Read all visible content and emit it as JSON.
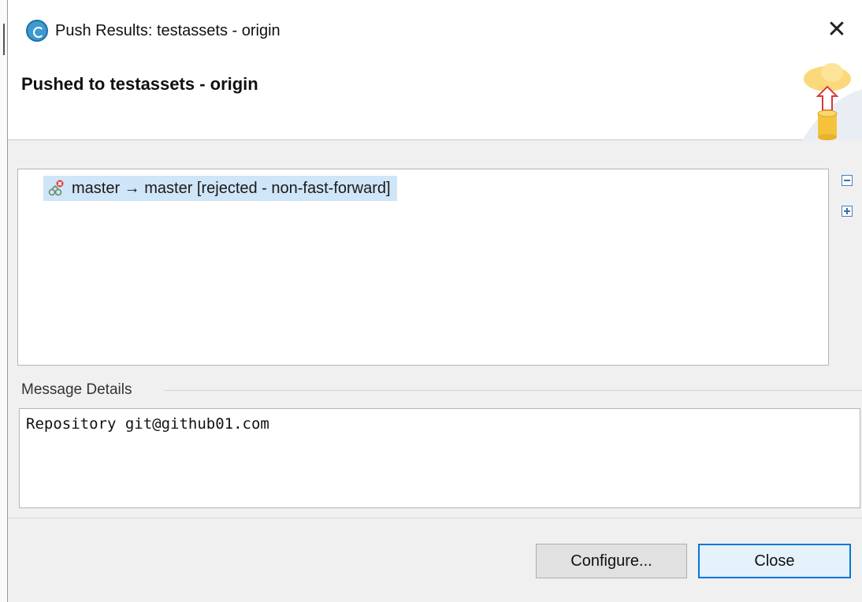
{
  "window": {
    "title": "Push Results: testassets - origin",
    "close_glyph": "✕"
  },
  "header": {
    "title": "Pushed to testassets - origin",
    "graphic_icon": "cloud-push-database-icon"
  },
  "results": {
    "items": [
      {
        "icon": "branch-rejected-icon",
        "label": "master → master [rejected - non-fast-forward]",
        "selected": true
      }
    ],
    "collapse_icon": "collapse-all-icon",
    "expand_icon": "expand-all-icon"
  },
  "message": {
    "label": "Message Details",
    "text": "Repository git@github01.com"
  },
  "buttons": {
    "configure": "Configure...",
    "close": "Close"
  },
  "colors": {
    "selection": "#cfe5f8",
    "focus_border": "#0078d7",
    "dialog_bg": "#f0f0f0"
  }
}
